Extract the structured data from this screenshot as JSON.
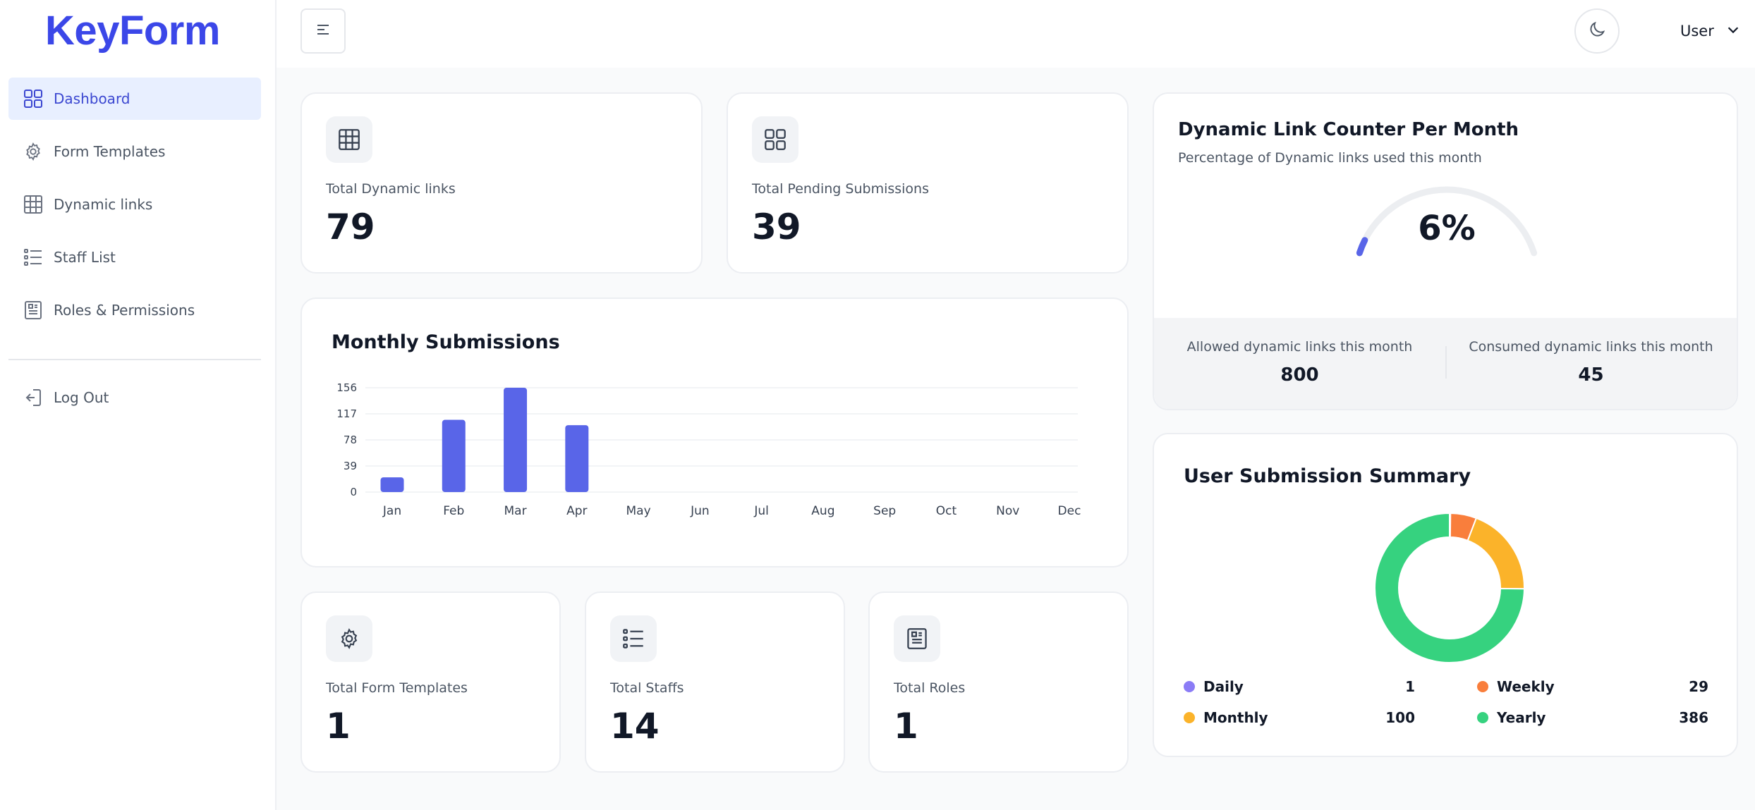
{
  "brand": {
    "name": "KeyForm"
  },
  "sidebar": {
    "items": [
      {
        "label": "Dashboard",
        "icon": "grid-icon",
        "active": true
      },
      {
        "label": "Form Templates",
        "icon": "gear-icon"
      },
      {
        "label": "Dynamic links",
        "icon": "table-icon"
      },
      {
        "label": "Staff List",
        "icon": "list-icon"
      },
      {
        "label": "Roles & Permissions",
        "icon": "badge-icon"
      }
    ],
    "logout_label": "Log Out"
  },
  "header": {
    "user_label": "User"
  },
  "stats": {
    "total_dynamic_links": {
      "label": "Total Dynamic links",
      "value": "79"
    },
    "total_pending_submissions": {
      "label": "Total Pending Submissions",
      "value": "39"
    },
    "total_form_templates": {
      "label": "Total Form Templates",
      "value": "1"
    },
    "total_staffs": {
      "label": "Total Staffs",
      "value": "14"
    },
    "total_roles": {
      "label": "Total Roles",
      "value": "1"
    }
  },
  "dynamic_link_counter": {
    "title": "Dynamic Link Counter Per Month",
    "subtitle": "Percentage of Dynamic links used this month",
    "percent_label": "6%",
    "percent": 6,
    "allowed_label": "Allowed dynamic links this month",
    "allowed_value": "800",
    "consumed_label": "Consumed dynamic links this month",
    "consumed_value": "45"
  },
  "chart_data": [
    {
      "type": "bar",
      "title": "Monthly Submissions",
      "categories": [
        "Jan",
        "Feb",
        "Mar",
        "Apr",
        "May",
        "Jun",
        "Jul",
        "Aug",
        "Sep",
        "Oct",
        "Nov",
        "Dec"
      ],
      "values": [
        22,
        108,
        156,
        100,
        0,
        0,
        0,
        0,
        0,
        0,
        0,
        0
      ],
      "yticks": [
        0,
        39,
        78,
        117,
        156
      ],
      "ylim": [
        0,
        156
      ],
      "grid": true,
      "color": "#5965e8"
    },
    {
      "type": "pie",
      "title": "User Submission Summary",
      "categories": [
        "Daily",
        "Weekly",
        "Monthly",
        "Yearly"
      ],
      "values": [
        1,
        29,
        100,
        386
      ],
      "colors": [
        "#8b7cf6",
        "#f97e3c",
        "#fbb32a",
        "#36d27f"
      ],
      "legend": "bottom"
    }
  ],
  "summary_legend": [
    {
      "label": "Daily",
      "value": "1",
      "color": "#8b7cf6"
    },
    {
      "label": "Weekly",
      "value": "29",
      "color": "#f97e3c"
    },
    {
      "label": "Monthly",
      "value": "100",
      "color": "#fbb32a"
    },
    {
      "label": "Yearly",
      "value": "386",
      "color": "#36d27f"
    }
  ]
}
